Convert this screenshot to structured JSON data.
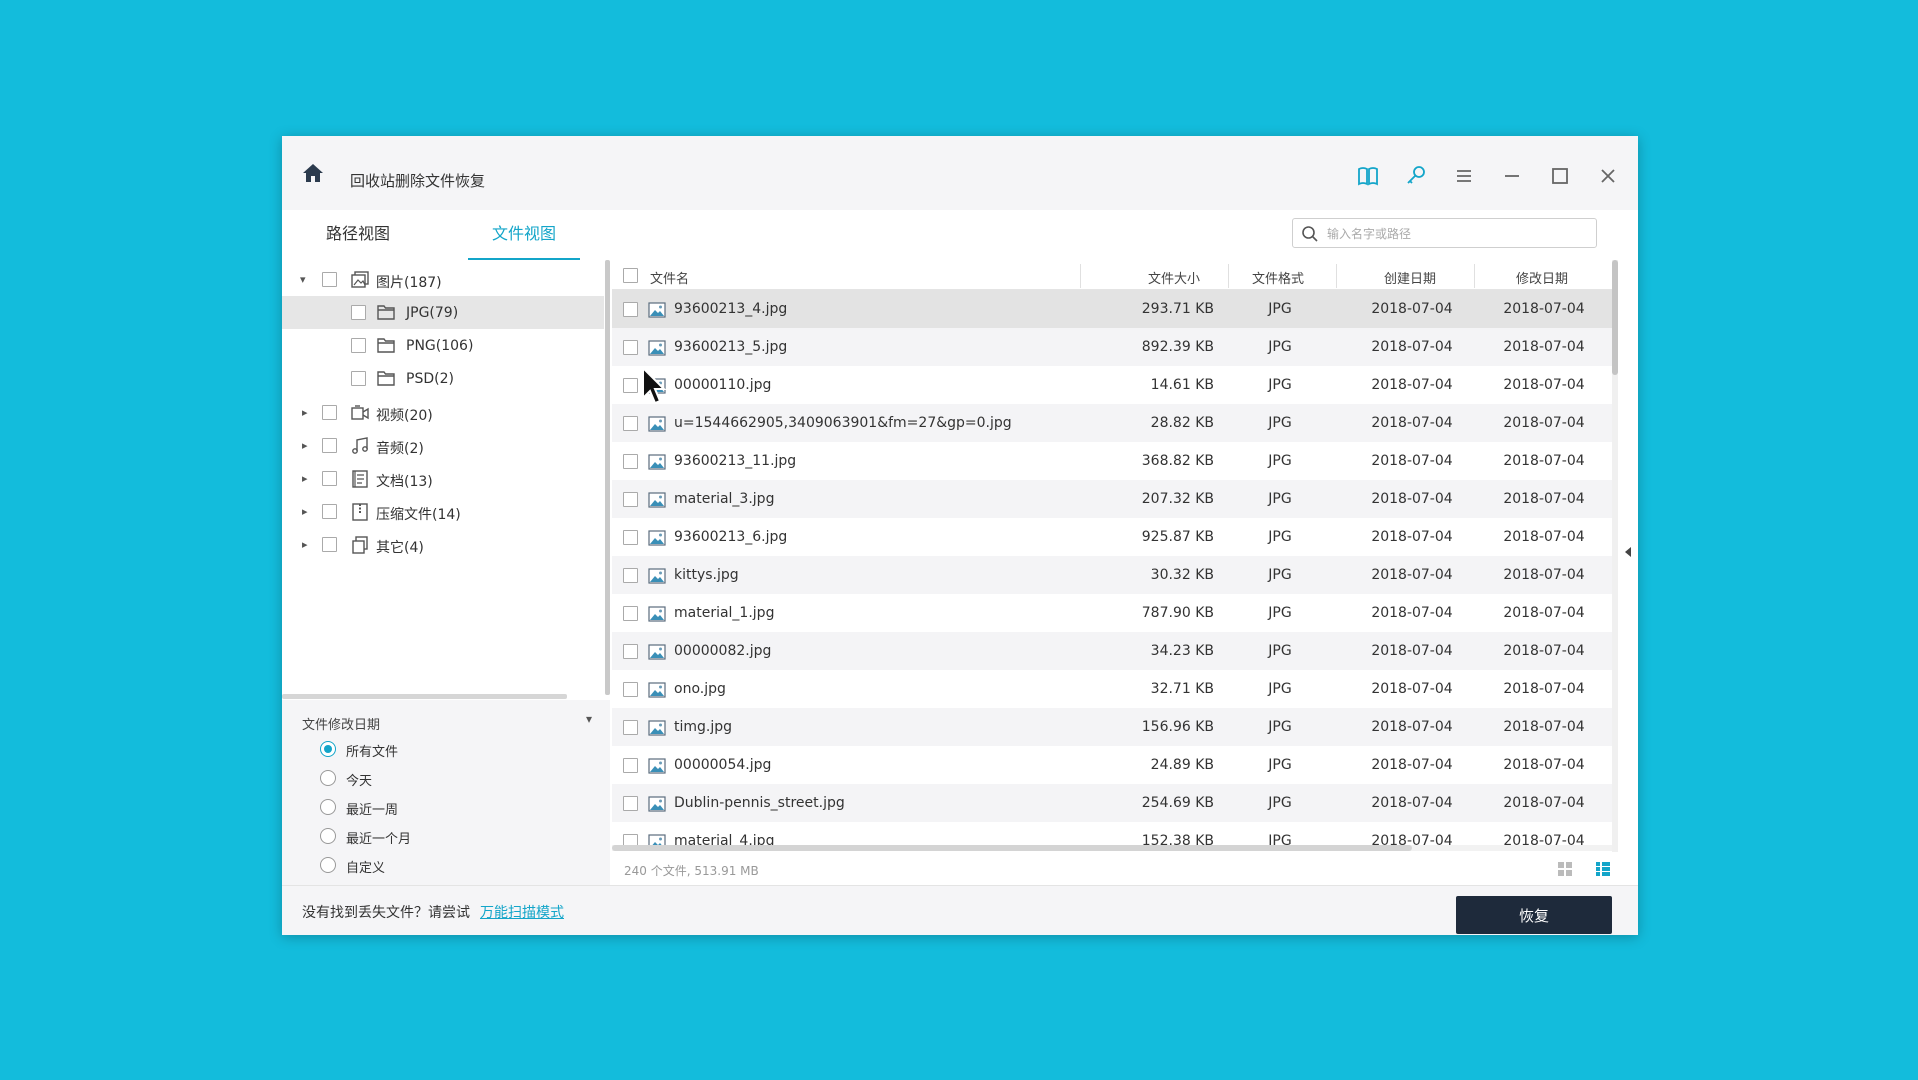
{
  "window": {
    "title": "回收站删除文件恢复"
  },
  "tabs": [
    {
      "label": "路径视图",
      "active": false
    },
    {
      "label": "文件视图",
      "active": true
    }
  ],
  "search": {
    "placeholder": "输入名字或路径"
  },
  "titlebar_icons": [
    "book-icon",
    "key-icon",
    "menu-icon",
    "minimize-icon",
    "maximize-icon",
    "close-icon"
  ],
  "tree": [
    {
      "label": "图片(187)",
      "icon": "image-category-icon",
      "expanded": true,
      "level": 0
    },
    {
      "label": "JPG(79)",
      "icon": "folder-icon",
      "level": 1,
      "selected": true
    },
    {
      "label": "PNG(106)",
      "icon": "folder-icon",
      "level": 1
    },
    {
      "label": "PSD(2)",
      "icon": "folder-icon",
      "level": 1
    },
    {
      "label": "视频(20)",
      "icon": "video-icon",
      "expanded": false,
      "level": 0
    },
    {
      "label": "音频(2)",
      "icon": "music-icon",
      "expanded": false,
      "level": 0
    },
    {
      "label": "文档(13)",
      "icon": "document-icon",
      "expanded": false,
      "level": 0
    },
    {
      "label": "压缩文件(14)",
      "icon": "archive-icon",
      "expanded": false,
      "level": 0
    },
    {
      "label": "其它(4)",
      "icon": "other-files-icon",
      "expanded": false,
      "level": 0
    }
  ],
  "filter": {
    "title": "文件修改日期",
    "options": [
      {
        "label": "所有文件",
        "checked": true
      },
      {
        "label": "今天",
        "checked": false
      },
      {
        "label": "最近一周",
        "checked": false
      },
      {
        "label": "最近一个月",
        "checked": false
      },
      {
        "label": "自定义",
        "checked": false
      }
    ]
  },
  "table": {
    "headers": {
      "name": "文件名",
      "size": "文件大小",
      "format": "文件格式",
      "created": "创建日期",
      "modified": "修改日期"
    },
    "rows": [
      {
        "name": "93600213_4.jpg",
        "size": "293.71 KB",
        "format": "JPG",
        "created": "2018-07-04",
        "modified": "2018-07-04"
      },
      {
        "name": "93600213_5.jpg",
        "size": "892.39 KB",
        "format": "JPG",
        "created": "2018-07-04",
        "modified": "2018-07-04"
      },
      {
        "name": "00000110.jpg",
        "size": "14.61 KB",
        "format": "JPG",
        "created": "2018-07-04",
        "modified": "2018-07-04"
      },
      {
        "name": "u=1544662905,3409063901&fm=27&gp=0.jpg",
        "size": "28.82 KB",
        "format": "JPG",
        "created": "2018-07-04",
        "modified": "2018-07-04"
      },
      {
        "name": "93600213_11.jpg",
        "size": "368.82 KB",
        "format": "JPG",
        "created": "2018-07-04",
        "modified": "2018-07-04"
      },
      {
        "name": "material_3.jpg",
        "size": "207.32 KB",
        "format": "JPG",
        "created": "2018-07-04",
        "modified": "2018-07-04"
      },
      {
        "name": "93600213_6.jpg",
        "size": "925.87 KB",
        "format": "JPG",
        "created": "2018-07-04",
        "modified": "2018-07-04"
      },
      {
        "name": "kittys.jpg",
        "size": "30.32 KB",
        "format": "JPG",
        "created": "2018-07-04",
        "modified": "2018-07-04"
      },
      {
        "name": "material_1.jpg",
        "size": "787.90 KB",
        "format": "JPG",
        "created": "2018-07-04",
        "modified": "2018-07-04"
      },
      {
        "name": "00000082.jpg",
        "size": "34.23 KB",
        "format": "JPG",
        "created": "2018-07-04",
        "modified": "2018-07-04"
      },
      {
        "name": "ono.jpg",
        "size": "32.71 KB",
        "format": "JPG",
        "created": "2018-07-04",
        "modified": "2018-07-04"
      },
      {
        "name": "timg.jpg",
        "size": "156.96 KB",
        "format": "JPG",
        "created": "2018-07-04",
        "modified": "2018-07-04"
      },
      {
        "name": "00000054.jpg",
        "size": "24.89 KB",
        "format": "JPG",
        "created": "2018-07-04",
        "modified": "2018-07-04"
      },
      {
        "name": "Dublin-pennis_street.jpg",
        "size": "254.69 KB",
        "format": "JPG",
        "created": "2018-07-04",
        "modified": "2018-07-04"
      },
      {
        "name": "material_4.jpg",
        "size": "152.38 KB",
        "format": "JPG",
        "created": "2018-07-04",
        "modified": "2018-07-04"
      }
    ],
    "summary": "240 个文件, 513.91 MB"
  },
  "footer": {
    "text": "没有找到丢失文件？请尝试",
    "link": "万能扫描模式",
    "recover_label": "恢复"
  },
  "colors": {
    "background": "#13bcdc",
    "accent": "#13a5c9",
    "button": "#1e2a3b"
  }
}
